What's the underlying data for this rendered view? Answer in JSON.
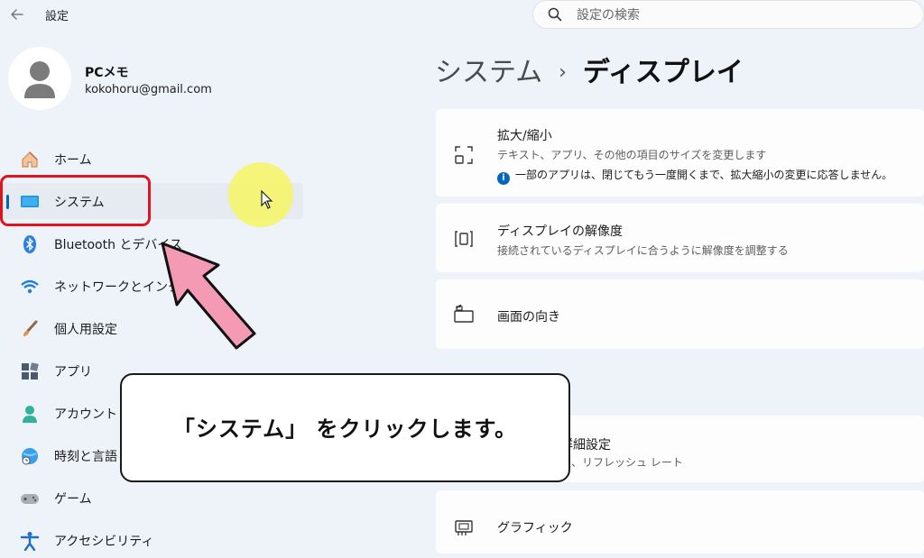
{
  "window": {
    "title": "設定",
    "back_icon": "back-arrow-icon"
  },
  "search": {
    "placeholder": "設定の検索",
    "value": "",
    "icon": "search-icon"
  },
  "profile": {
    "name": "PCメモ",
    "email": "kokohoru@gmail.com",
    "avatar_icon": "user-avatar-icon"
  },
  "sidebar": {
    "items": [
      {
        "label": "ホーム",
        "icon": "home-icon"
      },
      {
        "label": "システム",
        "icon": "system-display-icon",
        "selected": true
      },
      {
        "label": "Bluetooth とデバイス",
        "icon": "bluetooth-icon"
      },
      {
        "label": "ネットワークとインター",
        "icon": "wifi-icon"
      },
      {
        "label": "個人用設定",
        "icon": "brush-icon"
      },
      {
        "label": "アプリ",
        "icon": "apps-icon"
      },
      {
        "label": "アカウント",
        "icon": "account-icon"
      },
      {
        "label": "時刻と言語",
        "icon": "globe-clock-icon"
      },
      {
        "label": "ゲーム",
        "icon": "gamepad-icon"
      },
      {
        "label": "アクセシビリティ",
        "icon": "accessibility-icon"
      }
    ]
  },
  "breadcrumb": {
    "parent": "システム",
    "separator": "›",
    "current": "ディスプレイ"
  },
  "cards": [
    {
      "title": "拡大/縮小",
      "subtitle": "テキスト、アプリ、その他の項目のサイズを変更します",
      "info": "一部のアプリは、閉じてもう一度開くまで、拡大縮小の変更に応答しません。",
      "icon": "scale-icon"
    },
    {
      "title": "ディスプレイの解像度",
      "subtitle": "接続されているディスプレイに合うように解像度を調整する",
      "icon": "resolution-icon"
    },
    {
      "title": "画面の向き",
      "icon": "orientation-icon"
    },
    {
      "title": "詳細設定",
      "subtitle": "報、リフレッシュ レート",
      "icon": "advanced-display-icon"
    },
    {
      "title": "グラフィック",
      "icon": "graphics-card-icon"
    }
  ],
  "annotation": {
    "text": "「システム」 をクリックします。",
    "highlight_color": "#e0141e",
    "arrow_color": "#f49ab4"
  },
  "colors": {
    "accent": "#0067c0",
    "background": "#eef2f9",
    "card": "#fdfdfe"
  }
}
